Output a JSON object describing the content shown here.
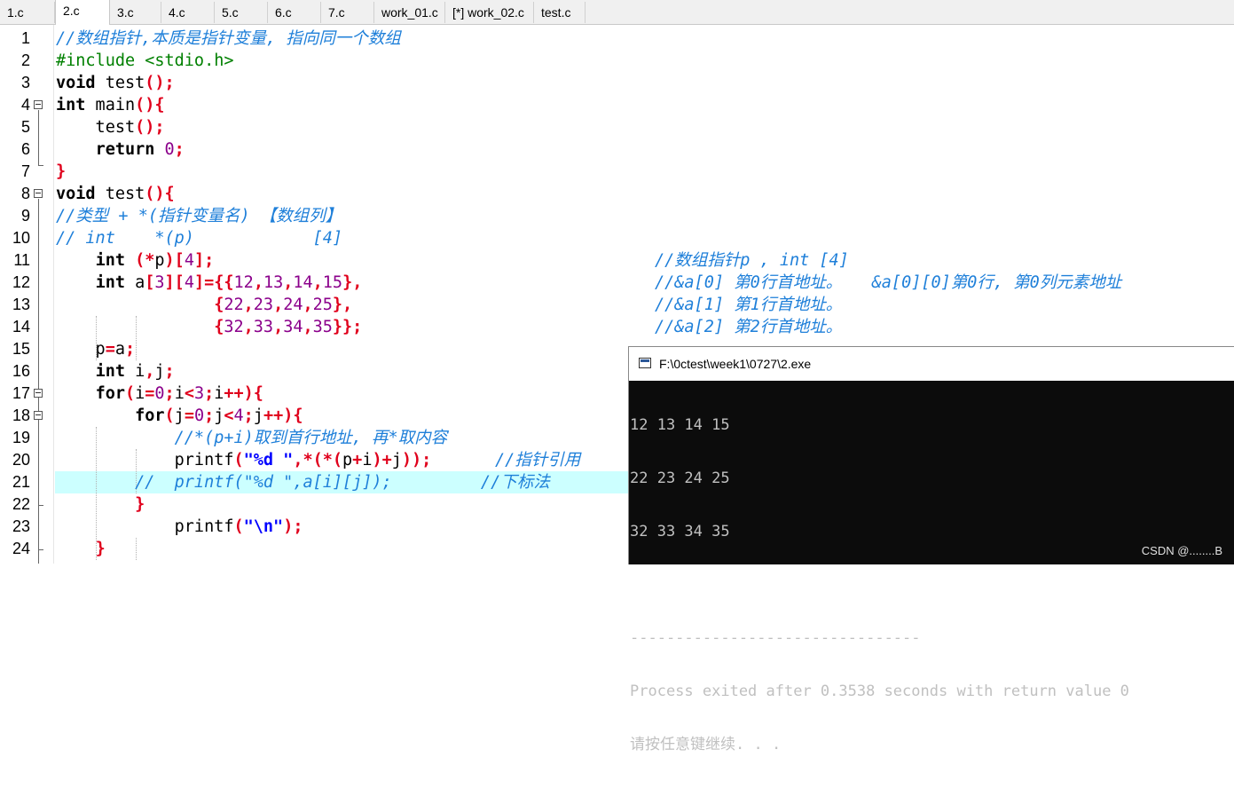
{
  "tabs": [
    {
      "label": "1.c"
    },
    {
      "label": "2.c"
    },
    {
      "label": "3.c"
    },
    {
      "label": "4.c"
    },
    {
      "label": "5.c"
    },
    {
      "label": "6.c"
    },
    {
      "label": "7.c"
    },
    {
      "label": "work_01.c"
    },
    {
      "label": "[*] work_02.c"
    },
    {
      "label": "test.c"
    }
  ],
  "editor": {
    "line_numbers": [
      "1",
      "2",
      "3",
      "4",
      "5",
      "6",
      "7",
      "8",
      "9",
      "10",
      "11",
      "12",
      "13",
      "14",
      "15",
      "16",
      "17",
      "18",
      "19",
      "20",
      "21",
      "22",
      "23",
      "24"
    ],
    "l1": "//数组指针,本质是指针变量, 指向同一个数组",
    "l2": "#include <stdio.h>",
    "l9": "//类型 + *(指针变量名) 【数组列】",
    "l10": "// int    *(p)            [4]",
    "c11": "//数组指针p , int [4]",
    "c12": "//&a[0] 第0行首地址。   &a[0][0]第0行, 第0列元素地址",
    "c13": "//&a[1] 第1行首地址。",
    "c14": "//&a[2] 第2行首地址。",
    "l19": "//*(p+i)取到首行地址, 再*取内容",
    "c20": "//指针引用",
    "l21": "//  printf(\"%d \",a[i][j]);         //下标法"
  },
  "console": {
    "title": "F:\\0ctest\\week1\\0727\\2.exe",
    "lines": [
      "12 13 14 15",
      "22 23 24 25",
      "32 33 34 35",
      "",
      "--------------------------------",
      "Process exited after 0.3538 seconds with return value 0",
      "请按任意键继续. . ."
    ]
  },
  "watermark": "CSDN @........B"
}
